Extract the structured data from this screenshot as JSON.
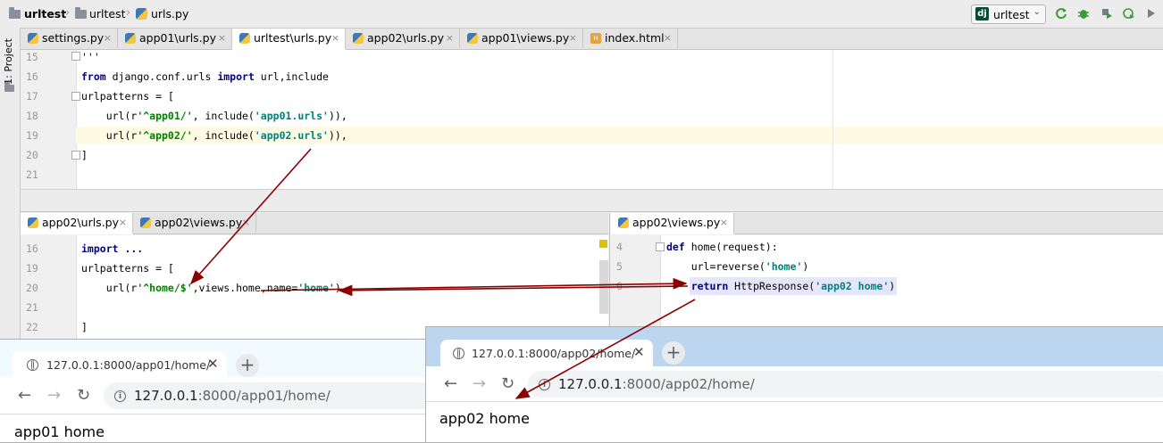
{
  "navbar": {
    "breadcrumbs": [
      "urltest",
      "urltest",
      "urls.py"
    ],
    "run_config": "urltest",
    "run_config_icon": "dj"
  },
  "sidebar": {
    "label": "1: Project"
  },
  "top_tabs": [
    {
      "label": "settings.py"
    },
    {
      "label": "app01\\urls.py"
    },
    {
      "label": "urltest\\urls.py",
      "active": true
    },
    {
      "label": "app02\\urls.py"
    },
    {
      "label": "app01\\views.py"
    },
    {
      "label": "index.html"
    }
  ],
  "top_editor": {
    "line_numbers": [
      "15",
      "16",
      "17",
      "18",
      "19",
      "20",
      "21"
    ],
    "lines": [
      [
        {
          "t": "'''",
          "c": ""
        }
      ],
      [
        {
          "t": "from",
          "c": "kw"
        },
        {
          "t": " django.conf.urls ",
          "c": ""
        },
        {
          "t": "import",
          "c": "kw"
        },
        {
          "t": " url,include",
          "c": ""
        }
      ],
      [
        {
          "t": "urlpatterns = [",
          "c": ""
        }
      ],
      [
        {
          "t": "    url(r",
          "c": ""
        },
        {
          "t": "'^app01/'",
          "c": "strg"
        },
        {
          "t": ", include(",
          "c": ""
        },
        {
          "t": "'app01.urls'",
          "c": "str"
        },
        {
          "t": ")),",
          "c": ""
        }
      ],
      [
        {
          "t": "    url(r",
          "c": ""
        },
        {
          "t": "'^app02/'",
          "c": "strg"
        },
        {
          "t": ", include(",
          "c": ""
        },
        {
          "t": "'app02.urls'",
          "c": "str"
        },
        {
          "t": ")),",
          "c": ""
        }
      ],
      [
        {
          "t": "]",
          "c": ""
        }
      ],
      [
        {
          "t": "",
          "c": ""
        }
      ]
    ]
  },
  "left_tabs": [
    {
      "label": "app02\\urls.py",
      "active": true
    },
    {
      "label": "app02\\views.py"
    }
  ],
  "left_editor": {
    "line_numbers": [
      "16",
      "19",
      "20",
      "21",
      "22"
    ],
    "lines": [
      [
        {
          "t": "import ...",
          "c": "kw"
        }
      ],
      [
        {
          "t": "urlpatterns = [",
          "c": ""
        }
      ],
      [
        {
          "t": "    url(r",
          "c": ""
        },
        {
          "t": "'^home/$'",
          "c": "strg"
        },
        {
          "t": ",views.home,name=",
          "c": ""
        },
        {
          "t": "'home'",
          "c": "str"
        },
        {
          "t": "),",
          "c": ""
        }
      ],
      [
        {
          "t": "",
          "c": ""
        }
      ],
      [
        {
          "t": "]",
          "c": ""
        }
      ]
    ]
  },
  "right_tabs": [
    {
      "label": "app02\\views.py",
      "active": true
    }
  ],
  "right_editor": {
    "line_numbers": [
      "4",
      "5",
      "6"
    ],
    "lines": [
      [
        {
          "t": "def",
          "c": "kw"
        },
        {
          "t": " home(request):",
          "c": ""
        }
      ],
      [
        {
          "t": "    url=reverse(",
          "c": ""
        },
        {
          "t": "'home'",
          "c": "str"
        },
        {
          "t": ")",
          "c": ""
        }
      ],
      [
        {
          "t": "    ",
          "c": ""
        },
        {
          "t": "return",
          "c": "kw"
        },
        {
          "t": " HttpResponse(",
          "c": ""
        },
        {
          "t": "'app02 home'",
          "c": "str"
        },
        {
          "t": ")",
          "c": ""
        }
      ]
    ]
  },
  "browser1": {
    "tab_title": "127.0.0.1:8000/app01/home/",
    "url_host": "127.0.0.1",
    "url_rest": ":8000/app01/home/",
    "content": "app01 home"
  },
  "browser2": {
    "tab_title": "127.0.0.1:8000/app02/home/",
    "url_host": "127.0.0.1",
    "url_rest": ":8000/app02/home/",
    "content": "app02 home"
  },
  "colors": {
    "arrow": "#8b0000",
    "keyword": "#000080",
    "string": "#008080"
  }
}
